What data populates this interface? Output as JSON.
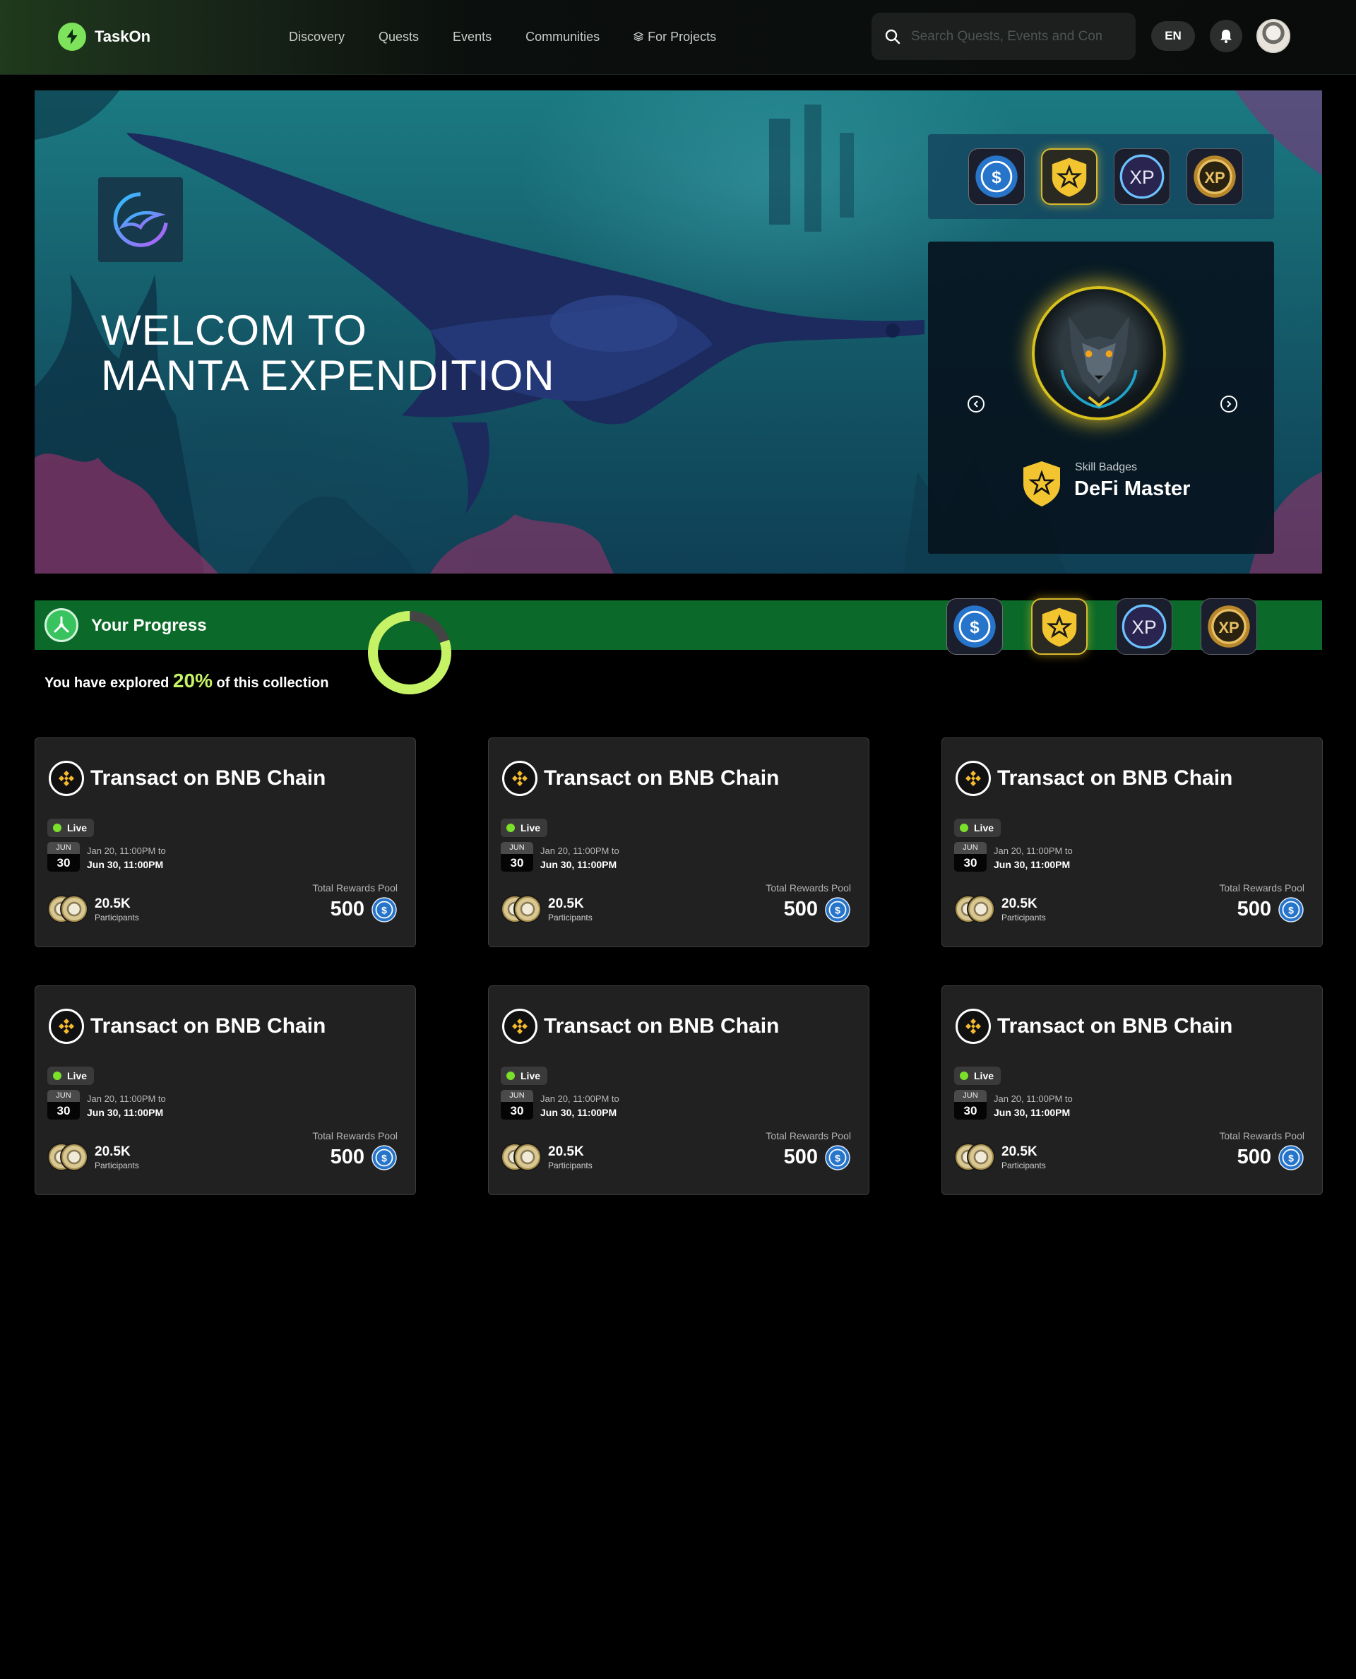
{
  "app": {
    "name": "TaskOn"
  },
  "nav": {
    "items": [
      {
        "label": "Discovery"
      },
      {
        "label": "Quests"
      },
      {
        "label": "Events"
      },
      {
        "label": "Communities"
      },
      {
        "label": "For Projects"
      }
    ]
  },
  "search": {
    "placeholder": "Search Quests, Events and Communities"
  },
  "header": {
    "lang": "EN"
  },
  "hero": {
    "title_line1": "WELCOM TO",
    "title_line2": "MANTA EXPENDITION",
    "reward_tokens": [
      "usdc-icon",
      "star-shield-icon",
      "xp-icon",
      "gold-xp-coin-icon"
    ],
    "featured_badge": {
      "category": "Skill Badges",
      "name": "DeFi Master",
      "image": "wolf-badge-icon"
    }
  },
  "progress": {
    "title": "Your Progress",
    "explored_prefix": "You have explored",
    "explored_percent": "20%",
    "explored_suffix": "of this collection",
    "fraction": 0.2,
    "reward_tokens": [
      "usdc-icon",
      "star-shield-icon",
      "xp-icon",
      "gold-xp-coin-icon"
    ]
  },
  "cards": [
    {
      "title": "Transact on BNB Chain",
      "status": "Live",
      "month": "JUN",
      "day": "30",
      "start": "Jan 20, 11:00PM to",
      "end": "Jun 30, 11:00PM",
      "participants": "20.5K",
      "participants_label": "Participants",
      "pool_label": "Total Rewards Pool",
      "pool_value": "500"
    },
    {
      "title": "Transact on BNB Chain",
      "status": "Live",
      "month": "JUN",
      "day": "30",
      "start": "Jan 20, 11:00PM to",
      "end": "Jun 30, 11:00PM",
      "participants": "20.5K",
      "participants_label": "Participants",
      "pool_label": "Total Rewards Pool",
      "pool_value": "500"
    },
    {
      "title": "Transact on BNB Chain",
      "status": "Live",
      "month": "JUN",
      "day": "30",
      "start": "Jan 20, 11:00PM to",
      "end": "Jun 30, 11:00PM",
      "participants": "20.5K",
      "participants_label": "Participants",
      "pool_label": "Total Rewards Pool",
      "pool_value": "500"
    },
    {
      "title": "Transact on BNB Chain",
      "status": "Live",
      "month": "JUN",
      "day": "30",
      "start": "Jan 20, 11:00PM to",
      "end": "Jun 30, 11:00PM",
      "participants": "20.5K",
      "participants_label": "Participants",
      "pool_label": "Total Rewards Pool",
      "pool_value": "500"
    },
    {
      "title": "Transact on BNB Chain",
      "status": "Live",
      "month": "JUN",
      "day": "30",
      "start": "Jan 20, 11:00PM to",
      "end": "Jun 30, 11:00PM",
      "participants": "20.5K",
      "participants_label": "Participants",
      "pool_label": "Total Rewards Pool",
      "pool_value": "500"
    },
    {
      "title": "Transact on BNB Chain",
      "status": "Live",
      "month": "JUN",
      "day": "30",
      "start": "Jan 20, 11:00PM to",
      "end": "Jun 30, 11:00PM",
      "participants": "20.5K",
      "participants_label": "Participants",
      "pool_label": "Total Rewards Pool",
      "pool_value": "500"
    }
  ],
  "colors": {
    "accent_green": "#7ce35a",
    "progress_bar": "#0b6a29",
    "progress_fill": "#c6f365",
    "live_dot": "#7be02a",
    "badge_gold": "#f2c530",
    "bnb_gold": "#f3ba2f"
  }
}
